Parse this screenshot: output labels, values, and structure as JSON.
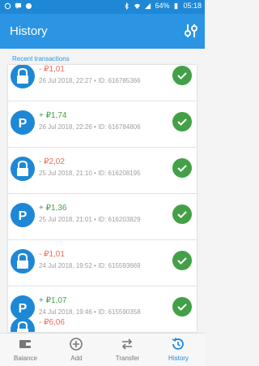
{
  "status": {
    "battery": "64%",
    "time": "05:18"
  },
  "header": {
    "title": "History"
  },
  "section_title": "Recent transactions",
  "transactions": [
    {
      "amount": "- ₽1,01",
      "meta": "26 Jul 2018, 22:27 • ID: 616785366",
      "type": "withdrawal"
    },
    {
      "amount": "+ ₽1,74",
      "meta": "26 Jul 2018, 22:26 • ID: 616784806",
      "type": "deposit"
    },
    {
      "amount": "- ₽2,02",
      "meta": "25 Jul 2018, 21:10 • ID: 616208195",
      "type": "withdrawal"
    },
    {
      "amount": "+ ₽1,36",
      "meta": "25 Jul 2018, 21:01 • ID: 616203829",
      "type": "deposit"
    },
    {
      "amount": "- ₽1,01",
      "meta": "24 Jul 2018, 19:52 • ID: 615593669",
      "type": "withdrawal"
    },
    {
      "amount": "+ ₽1,07",
      "meta": "24 Jul 2018, 19:46 • ID: 615590358",
      "type": "deposit"
    },
    {
      "amount": "- ₽6,06",
      "meta": "",
      "type": "withdrawal"
    }
  ],
  "nav": [
    {
      "label": "Balance",
      "icon": "wallet-icon"
    },
    {
      "label": "Add",
      "icon": "add-circle-icon"
    },
    {
      "label": "Transfer",
      "icon": "transfer-icon"
    },
    {
      "label": "History",
      "icon": "history-icon"
    }
  ],
  "colors": {
    "primary": "#2b95e3",
    "negative": "#ee6b52",
    "positive": "#43a047"
  }
}
